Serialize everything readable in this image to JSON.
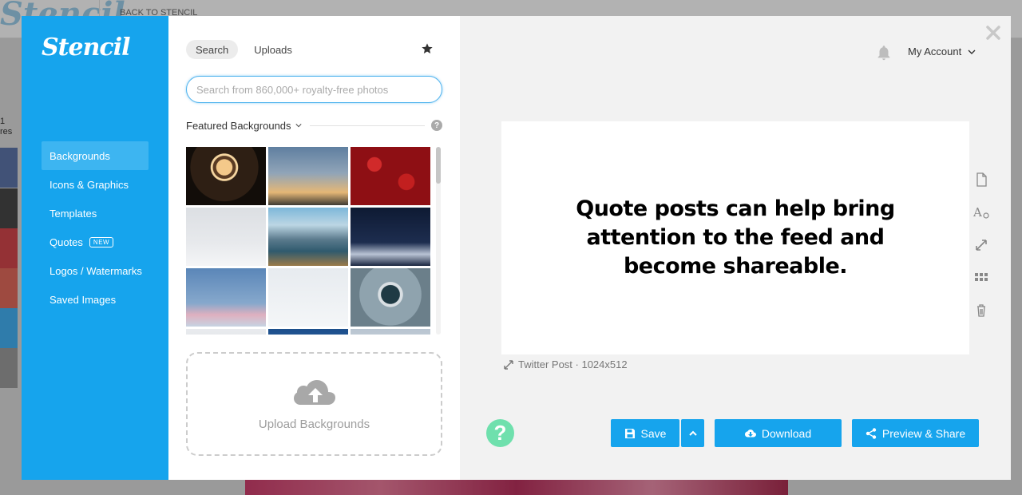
{
  "background_page": {
    "logo": "Stencil",
    "back_link": "BACK TO STENCIL",
    "share_count": "1",
    "shares_label": "res"
  },
  "sidebar": {
    "logo": "Stencil",
    "items": [
      {
        "label": "Backgrounds",
        "active": true
      },
      {
        "label": "Icons & Graphics"
      },
      {
        "label": "Templates"
      },
      {
        "label": "Quotes",
        "badge": "NEW"
      },
      {
        "label": "Logos / Watermarks"
      },
      {
        "label": "Saved Images"
      }
    ]
  },
  "panel": {
    "tabs": [
      {
        "label": "Search",
        "active": true
      },
      {
        "label": "Uploads"
      }
    ],
    "search": {
      "placeholder": "Search from 860,000+ royalty-free photos",
      "value": ""
    },
    "section_title": "Featured Backgrounds",
    "help_glyph": "?",
    "thumbnails": [
      {
        "name": "thumb-woman-lights",
        "bg": "radial-gradient(circle at 48% 35%, #f4c98a 0 14%, #5a3b23 15% 20%, #f6d6a0 21% 24%, #2e1f14 25% 60%, #120d09 61%)"
      },
      {
        "name": "thumb-sunset-couple",
        "bg": "linear-gradient(180deg, #5f7fa0 0%, #90a4b8 45%, #e5b776 78%, #3e3a33 100%)"
      },
      {
        "name": "thumb-red-roses",
        "bg": "radial-gradient(circle at 30% 30%, #d12a2a 0 10%, transparent 11%), radial-gradient(circle at 70% 60%, #c21f1f 0 12%, transparent 13%), #8e0f14"
      },
      {
        "name": "thumb-winter-tree",
        "bg": "linear-gradient(180deg, #dcdfe3 0%, #e7e9ec 60%, #f4f5f7 100%)"
      },
      {
        "name": "thumb-mountain-lake",
        "bg": "linear-gradient(180deg, #7db7d9 0%, #bcd6e4 30%, #5a7a8c 55%, #2f5a6e 75%, #9a7a4a 100%)"
      },
      {
        "name": "thumb-night-forest",
        "bg": "linear-gradient(180deg, #0e1a33 0%, #1d2d4f 60%, #b9c3d4 80%, #1a2640 100%)"
      },
      {
        "name": "thumb-pink-tree",
        "bg": "linear-gradient(180deg, #5a86b8 0%, #86a8cc 60%, #dfb0bf 80%, #c6d3e2 100%)"
      },
      {
        "name": "thumb-squirrel-snow",
        "bg": "linear-gradient(180deg, #e7ebef 0%, #f4f6f8 100%)"
      },
      {
        "name": "thumb-coffee-mittens",
        "bg": "radial-gradient(circle at 50% 45%, #1f3a44 0 18%, #d9dfe3 19% 24%, #8fa3ae 25% 60%, #6b7f8a 61%)"
      },
      {
        "name": "thumb-partial-1",
        "bg": "linear-gradient(180deg, #e9ebee, #cfd5dc)"
      },
      {
        "name": "thumb-partial-2",
        "bg": "linear-gradient(180deg, #1d4f8c, #3a77b5)"
      },
      {
        "name": "thumb-partial-3",
        "bg": "linear-gradient(180deg, #b9c5d1, #e1e6ea)"
      }
    ],
    "upload_label": "Upload Backgrounds"
  },
  "header": {
    "account_label": "My Account"
  },
  "canvas": {
    "quote_text": "Quote posts can help bring attention to the feed and become shareable.",
    "size_info": "Twitter Post · 1024x512"
  },
  "help_button": "?",
  "actions": {
    "save": "Save",
    "download": "Download",
    "preview_share": "Preview & Share"
  },
  "colors": {
    "brand_blue": "#16a4ed",
    "help_green": "#6fe0ad"
  }
}
